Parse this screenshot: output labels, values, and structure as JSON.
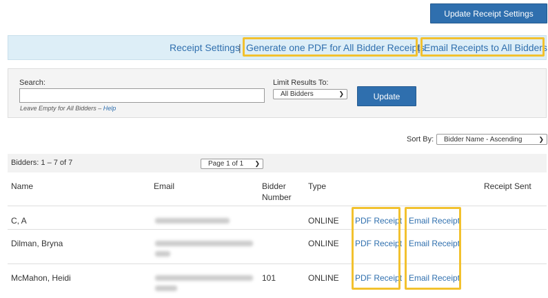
{
  "top_button": "Update Receipt Settings",
  "links": {
    "receipt_settings": "Receipt Settings",
    "sep1": "|",
    "generate_pdf": "Generate one PDF for All Bidder Receipts",
    "sep2": "|",
    "email_all": "Email Receipts to All Bidders"
  },
  "search": {
    "label": "Search:",
    "value": "",
    "hint": "Leave Empty for All Bidders –",
    "help": "Help",
    "limit_label": "Limit Results To:",
    "limit_value": "All Bidders",
    "update_label": "Update"
  },
  "sort": {
    "label": "Sort By:",
    "value": "Bidder Name - Ascending"
  },
  "list": {
    "count": "Bidders: 1 – 7 of 7",
    "page": "Page 1 of 1"
  },
  "columns": {
    "name": "Name",
    "email": "Email",
    "bidder_number_1": "Bidder",
    "bidder_number_2": "Number",
    "type": "Type",
    "receipt_sent": "Receipt Sent"
  },
  "rows": [
    {
      "name": "C, A",
      "number": "",
      "type": "ONLINE",
      "pdf": "PDF Receipt",
      "email_link": "Email Receipt"
    },
    {
      "name": "Dilman, Bryna",
      "number": "",
      "type": "ONLINE",
      "pdf": "PDF Receipt",
      "email_link": "Email Receipt"
    },
    {
      "name": "McMahon, Heidi",
      "number": "101",
      "type": "ONLINE",
      "pdf": "PDF Receipt",
      "email_link": "Email Receipt"
    }
  ],
  "colors": {
    "accent": "#2f6fae",
    "highlight": "#f2c12e",
    "links_bar": "#ddeef7"
  }
}
